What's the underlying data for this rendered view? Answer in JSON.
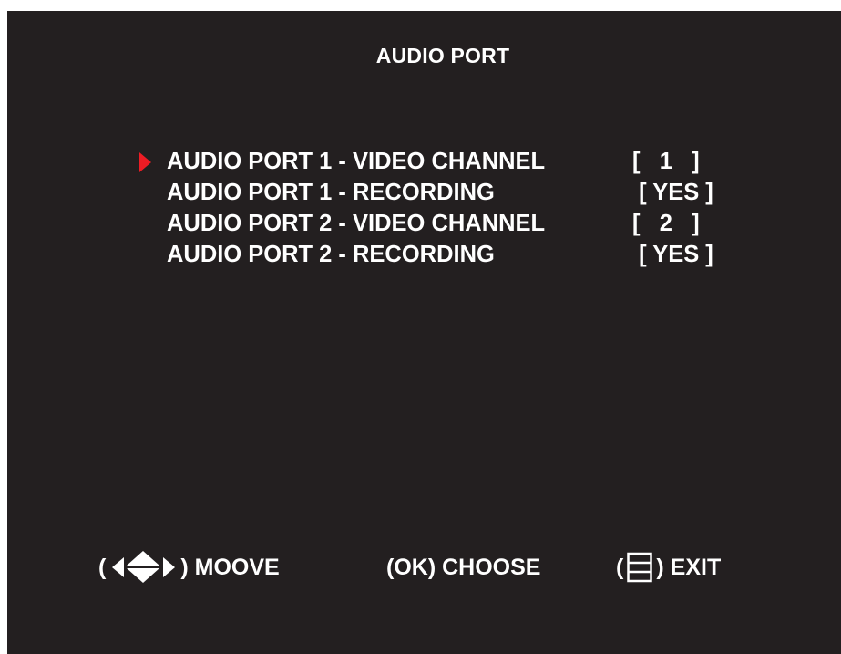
{
  "screen": {
    "title": "AUDIO PORT",
    "selected_index": 0,
    "rows": [
      {
        "label": "AUDIO PORT 1 - VIDEO CHANNEL",
        "value": "[   1   ]"
      },
      {
        "label": "AUDIO PORT 1 - RECORDING",
        "value": " [ YES ]"
      },
      {
        "label": "AUDIO PORT 2 - VIDEO CHANNEL",
        "value": "[   2   ]"
      },
      {
        "label": "AUDIO PORT 2 - RECORDING",
        "value": " [ YES ]"
      }
    ],
    "footer": {
      "move": {
        "open": "(",
        "close": ")",
        "label": "MOOVE",
        "icon": "four-way-arrows-icon"
      },
      "choose": {
        "label": "(OK) CHOOSE"
      },
      "exit": {
        "open": "(",
        "close": ")",
        "label": "EXIT",
        "icon": "menu-box-icon"
      }
    },
    "colors": {
      "background": "#231f20",
      "text": "#ffffff",
      "cursor": "#ed1c24"
    }
  }
}
